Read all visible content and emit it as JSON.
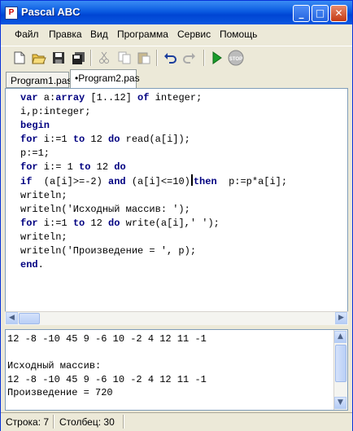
{
  "window": {
    "title": "Pascal ABC",
    "app_icon_glyph": "P",
    "minimize_glyph": "_",
    "maximize_glyph": "□",
    "close_glyph": "✕"
  },
  "menu": {
    "items": [
      "Файл",
      "Правка",
      "Вид",
      "Программа",
      "Сервис",
      "Помощь"
    ]
  },
  "toolbar": {
    "icons": [
      "new-file-icon",
      "open-folder-icon",
      "save-icon",
      "save-all-icon",
      "cut-icon",
      "copy-icon",
      "paste-icon",
      "undo-icon",
      "redo-icon",
      "run-icon",
      "stop-icon"
    ],
    "stop_label": "STOP"
  },
  "tabs": [
    {
      "label": "Program1.pas"
    },
    {
      "label": "•Program2.pas"
    }
  ],
  "editor": {
    "lines": [
      "var a:array [1..12] of integer;",
      "i,p:integer;",
      "begin",
      "for i:=1 to 12 do read(a[i]);",
      "p:=1;",
      "for i:= 1 to 12 do",
      "if  (a[i]>=-2) and (a[i]<=10) then  p:=p*a[i];",
      "writeln;",
      "writeln('Исходный массив: ');",
      "for i:=1 to 12 do write(a[i],' ');",
      "writeln;",
      "writeln('Произведение = ', p);",
      "end."
    ],
    "keywords": [
      "var",
      "array",
      "of",
      "begin",
      "for",
      "to",
      "do",
      "if",
      "and",
      "then",
      "end"
    ]
  },
  "output": {
    "lines": [
      "12 -8 -10 45 9 -6 10 -2 4 12 11 -1",
      "",
      "Исходный массив:",
      "12 -8 -10 45 9 -6 10 -2 4 12 11 -1",
      "Произведение = 720"
    ]
  },
  "status": {
    "line_label": "Строка: 7",
    "col_label": "Столбец: 30"
  },
  "colors": {
    "keyword": "#000080",
    "titlebar": "#0a5ae0"
  }
}
